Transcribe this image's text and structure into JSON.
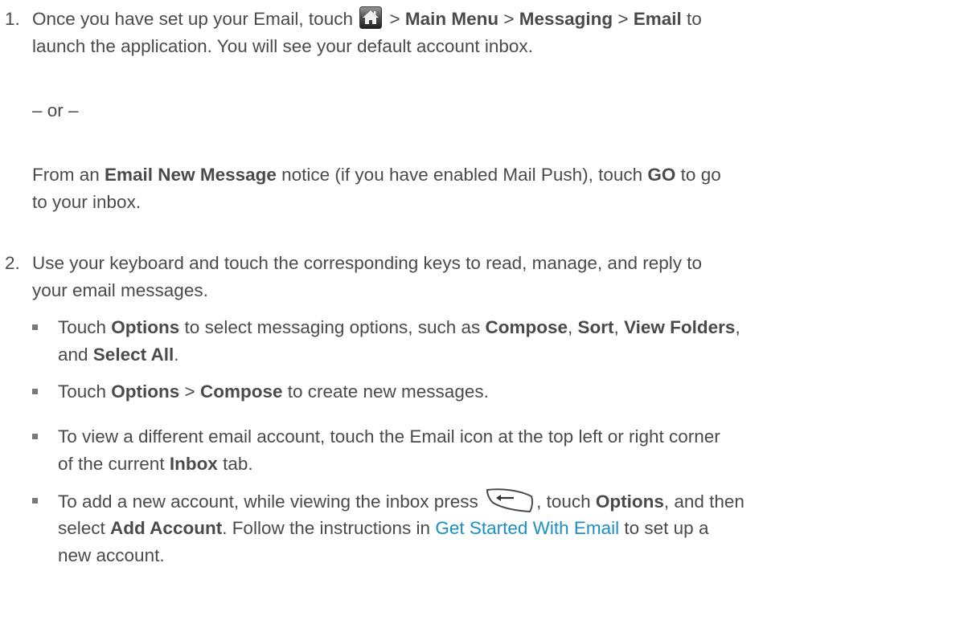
{
  "step1": {
    "number": "1.",
    "line1": {
      "a": "Once you have set up your Email, touch ",
      "sep1": " > ",
      "b": "Main Menu",
      "sep2": " > ",
      "c": "Messaging",
      "sep3": " > ",
      "d": "Email",
      "e": " to"
    },
    "line2": "launch the application. You will see your default account inbox.",
    "or": "– or –",
    "line3": {
      "a": "From an ",
      "b": "Email New Message",
      "c": " notice (if you have enabled Mail Push), touch ",
      "d": "GO",
      "e": " to go"
    },
    "line4": "to your inbox.",
    "home_icon": "home-icon"
  },
  "step2": {
    "number": "2.",
    "line1": "Use your keyboard and touch the corresponding keys to read, manage, and reply to",
    "line2": "your email messages."
  },
  "bullets": {
    "b1": {
      "l1": {
        "a": "Touch ",
        "b": "Options",
        "c": " to select messaging options, such as ",
        "d": "Compose",
        "e": ", ",
        "f": "Sort",
        "g": ", ",
        "h": "View Folders",
        "i": ","
      },
      "l2": {
        "a": "and ",
        "b": "Select All",
        "c": "."
      }
    },
    "b2": {
      "a": "Touch ",
      "b": "Options",
      "c": " > ",
      "d": "Compose",
      "e": " to create new messages."
    },
    "b3": {
      "l1": "To view a different email account, touch the Email icon at the top left or right corner",
      "l2": {
        "a": "of the current ",
        "b": "Inbox",
        "c": " tab."
      }
    },
    "b4": {
      "l1": {
        "a": "To add a new account, while viewing the inbox press ",
        "b": ", touch ",
        "c": "Options",
        "d": ", and then"
      },
      "l2": {
        "a": "select ",
        "b": "Add Account",
        "c": ". Follow the instructions in ",
        "link": "Get Started With Email",
        "d": " to set up a"
      },
      "l3": "new account.",
      "back_icon": "back-key-icon"
    }
  },
  "colors": {
    "text": "#4a4a4a",
    "link": "#1a8fc4",
    "bullet": "#7a7a7a"
  }
}
